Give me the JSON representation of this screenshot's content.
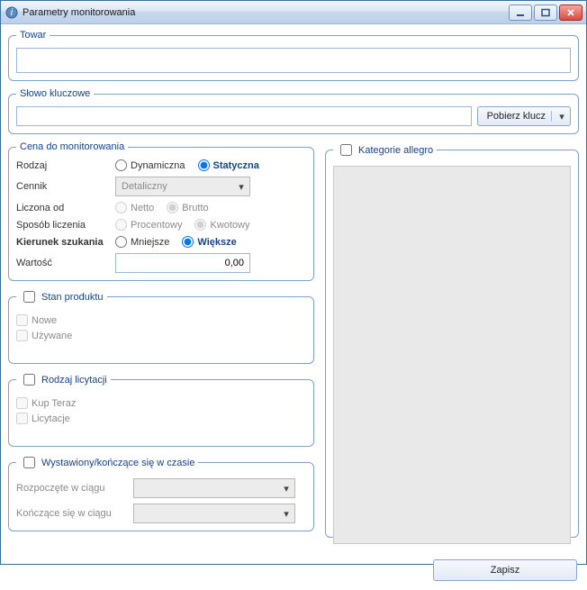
{
  "window": {
    "title": "Parametry monitorowania"
  },
  "towar": {
    "legend": "Towar"
  },
  "keyword": {
    "legend": "Słowo kluczowe",
    "fetch_label": "Pobierz klucz"
  },
  "price": {
    "legend": "Cena do monitorowania",
    "rodzaj": {
      "label": "Rodzaj",
      "opt_dynamic": "Dynamiczna",
      "opt_static": "Statyczna",
      "selected": "static"
    },
    "cennik": {
      "label": "Cennik",
      "value": "Detaliczny"
    },
    "liczona_od": {
      "label": "Liczona od",
      "opt_netto": "Netto",
      "opt_brutto": "Brutto",
      "selected": "brutto"
    },
    "sposob": {
      "label": "Sposób liczenia",
      "opt_proc": "Procentowy",
      "opt_kwot": "Kwotowy",
      "selected": "kwot"
    },
    "kierunek": {
      "label": "Kierunek szukania",
      "opt_mniejsze": "Mniejsze",
      "opt_wieksze": "Większe",
      "selected": "wieksze"
    },
    "wartosc": {
      "label": "Wartość",
      "value": "0,00"
    }
  },
  "stan": {
    "legend": "Stan produktu",
    "nowe": "Nowe",
    "uzywane": "Używane"
  },
  "licytacja": {
    "legend": "Rodzaj licytacji",
    "kup": "Kup Teraz",
    "lic": "Licytacje"
  },
  "czas": {
    "legend": "Wystawiony/kończące się w czasie",
    "row1": "Rozpoczęte w ciągu",
    "row2": "Kończące się w ciągu"
  },
  "kategorie": {
    "legend": "Kategorie allegro"
  },
  "footer": {
    "save": "Zapisz"
  }
}
